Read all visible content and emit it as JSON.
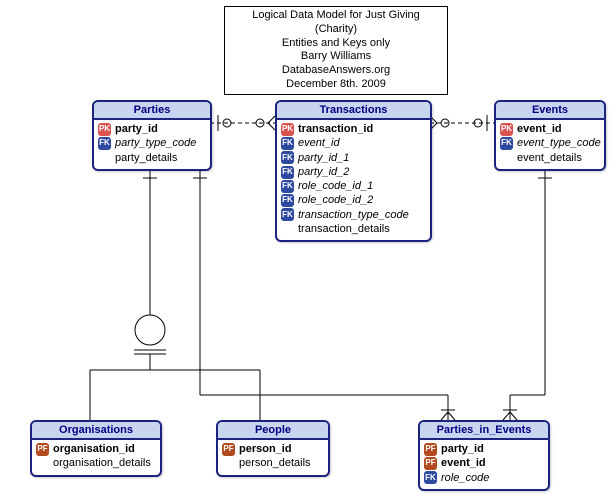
{
  "title": {
    "line1": "Logical Data Model for Just Giving (Charity)",
    "line2": "Entities and Keys only",
    "line3": "Barry Williams",
    "line4": "DatabaseAnswers.org",
    "line5": "December 8th. 2009"
  },
  "entities": {
    "parties": {
      "name": "Parties",
      "attrs": [
        {
          "key": "PK",
          "label": "party_id",
          "bold": true
        },
        {
          "key": "FK",
          "label": "party_type_code",
          "ital": true
        },
        {
          "key": "",
          "label": "party_details"
        }
      ]
    },
    "transactions": {
      "name": "Transactions",
      "attrs": [
        {
          "key": "PK",
          "label": "transaction_id",
          "bold": true
        },
        {
          "key": "FK",
          "label": "event_id",
          "ital": true
        },
        {
          "key": "FK",
          "label": "party_id_1",
          "ital": true
        },
        {
          "key": "FK",
          "label": "party_id_2",
          "ital": true
        },
        {
          "key": "FK",
          "label": "role_code_id_1",
          "ital": true
        },
        {
          "key": "FK",
          "label": "role_code_id_2",
          "ital": true
        },
        {
          "key": "FK",
          "label": "transaction_type_code",
          "ital": true
        },
        {
          "key": "",
          "label": "transaction_details"
        }
      ]
    },
    "events": {
      "name": "Events",
      "attrs": [
        {
          "key": "PK",
          "label": "event_id",
          "bold": true
        },
        {
          "key": "FK",
          "label": "event_type_code",
          "ital": true
        },
        {
          "key": "",
          "label": "event_details"
        }
      ]
    },
    "organisations": {
      "name": "Organisations",
      "attrs": [
        {
          "key": "PF",
          "label": "organisation_id",
          "bold": true
        },
        {
          "key": "",
          "label": "organisation_details"
        }
      ]
    },
    "people": {
      "name": "People",
      "attrs": [
        {
          "key": "PF",
          "label": "person_id",
          "bold": true
        },
        {
          "key": "",
          "label": "person_details"
        }
      ]
    },
    "parties_in_events": {
      "name": "Parties_in_Events",
      "attrs": [
        {
          "key": "PF",
          "label": "party_id",
          "bold": true
        },
        {
          "key": "PF",
          "label": "event_id",
          "bold": true
        },
        {
          "key": "FK",
          "label": "role_code",
          "ital": true
        }
      ]
    }
  },
  "chart_data": {
    "type": "er-diagram",
    "title": "Logical Data Model for Just Giving (Charity) — Entities and Keys only",
    "author": "Barry Williams",
    "source": "DatabaseAnswers.org",
    "date": "December 8th. 2009",
    "entities": [
      {
        "name": "Parties",
        "pk": [
          "party_id"
        ],
        "fk": [
          "party_type_code"
        ],
        "other": [
          "party_details"
        ]
      },
      {
        "name": "Transactions",
        "pk": [
          "transaction_id"
        ],
        "fk": [
          "event_id",
          "party_id_1",
          "party_id_2",
          "role_code_id_1",
          "role_code_id_2",
          "transaction_type_code"
        ],
        "other": [
          "transaction_details"
        ]
      },
      {
        "name": "Events",
        "pk": [
          "event_id"
        ],
        "fk": [
          "event_type_code"
        ],
        "other": [
          "event_details"
        ]
      },
      {
        "name": "Organisations",
        "pk_fk": [
          "organisation_id"
        ],
        "other": [
          "organisation_details"
        ]
      },
      {
        "name": "People",
        "pk_fk": [
          "person_id"
        ],
        "other": [
          "person_details"
        ]
      },
      {
        "name": "Parties_in_Events",
        "pk_fk": [
          "party_id",
          "event_id"
        ],
        "fk": [
          "role_code"
        ]
      }
    ],
    "relationships": [
      {
        "from": "Parties",
        "to": "Transactions",
        "type": "one-to-many-optional"
      },
      {
        "from": "Events",
        "to": "Transactions",
        "type": "one-to-many-optional"
      },
      {
        "from": "Parties",
        "to": "Parties_in_Events",
        "type": "one-to-many"
      },
      {
        "from": "Events",
        "to": "Parties_in_Events",
        "type": "one-to-many"
      },
      {
        "from": "Parties",
        "to": "Organisations",
        "type": "supertype-subtype"
      },
      {
        "from": "Parties",
        "to": "People",
        "type": "supertype-subtype"
      }
    ]
  }
}
